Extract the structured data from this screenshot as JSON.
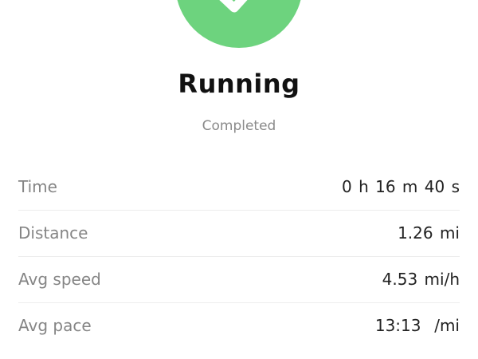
{
  "badge": {
    "icon": "checkmark-icon",
    "color": "#6dd37e"
  },
  "activity": {
    "title": "Running",
    "status": "Completed"
  },
  "stats": [
    {
      "label": "Time",
      "value": "0 h 16 m 40 s"
    },
    {
      "label": "Distance",
      "value": "1.26 mi"
    },
    {
      "label": "Avg speed",
      "value": "4.53 mi/h"
    },
    {
      "label": "Avg pace",
      "value": "13:13  /mi"
    }
  ]
}
